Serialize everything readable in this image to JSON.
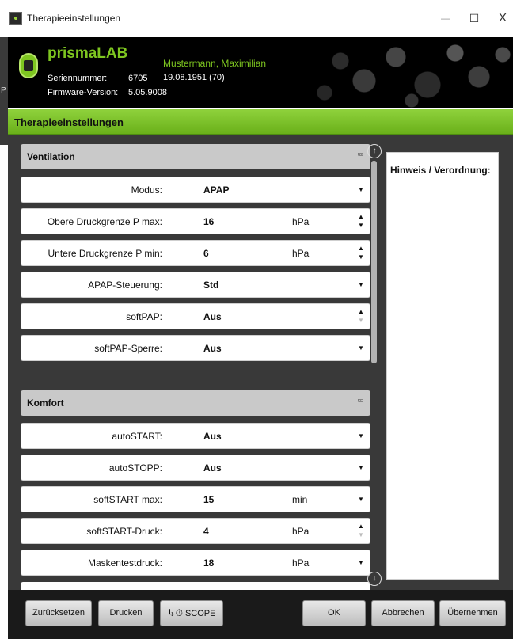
{
  "window": {
    "title": "Therapieeinstellungen",
    "min": "—",
    "max": "☐",
    "close": "X"
  },
  "device": {
    "name": "prismaLAB",
    "serial_label": "Seriennummer:",
    "serial": "6705",
    "firmware_label": "Firmware-Version:",
    "firmware": "5.05.9008"
  },
  "patient": {
    "name": "Mustermann, Maximilian",
    "dob": "19.08.1951  (70)"
  },
  "left_strip": "P",
  "section_title": "Therapieeinstellungen",
  "ventilation": {
    "title": "Ventilation",
    "collapse_icon": "«",
    "rows": [
      {
        "label": "Modus:",
        "value": "APAP",
        "unit": "",
        "control": "dropdown"
      },
      {
        "label": "Obere Druckgrenze P max:",
        "value": "16",
        "unit": "hPa",
        "control": "spin"
      },
      {
        "label": "Untere Druckgrenze P min:",
        "value": "6",
        "unit": "hPa",
        "control": "spin"
      },
      {
        "label": "APAP-Steuerung:",
        "value": "Std",
        "unit": "",
        "control": "dropdown"
      },
      {
        "label": "softPAP:",
        "value": "Aus",
        "unit": "",
        "control": "spin-up"
      },
      {
        "label": "softPAP-Sperre:",
        "value": "Aus",
        "unit": "",
        "control": "dropdown"
      }
    ]
  },
  "komfort": {
    "title": "Komfort",
    "collapse_icon": "«",
    "rows": [
      {
        "label": "autoSTART:",
        "value": "Aus",
        "unit": "",
        "control": "dropdown"
      },
      {
        "label": "autoSTOPP:",
        "value": "Aus",
        "unit": "",
        "control": "dropdown"
      },
      {
        "label": "softSTART max:",
        "value": "15",
        "unit": "min",
        "control": "dropdown"
      },
      {
        "label": "softSTART-Druck:",
        "value": "4",
        "unit": "hPa",
        "control": "spin-up"
      },
      {
        "label": "Maskentestdruck:",
        "value": "18",
        "unit": "hPa",
        "control": "dropdown"
      }
    ]
  },
  "notes_label": "Hinweis / Verordnung:",
  "footer": {
    "reset": "Zurücksetzen",
    "print": "Drucken",
    "scope": "SCOPE",
    "ok": "OK",
    "cancel": "Abbrechen",
    "apply": "Übernehmen"
  }
}
